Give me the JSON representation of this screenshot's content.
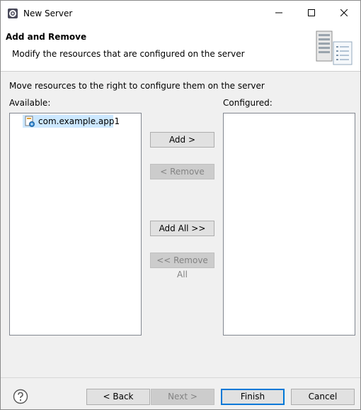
{
  "window": {
    "title": "New Server",
    "icons": {
      "app": "server-gear-icon",
      "minimize": "minimize-icon",
      "maximize": "maximize-icon",
      "close": "close-icon"
    }
  },
  "banner": {
    "title": "Add and Remove",
    "message": "Modify the resources that are configured on the server",
    "image": "server-document-icon"
  },
  "instruction": "Move resources to the right to configure them on the server",
  "available": {
    "label": "Available:",
    "items": [
      {
        "label": "com.example.app1",
        "icon": "web-module-icon",
        "selected": true
      }
    ]
  },
  "configured": {
    "label": "Configured:",
    "items": []
  },
  "actions": {
    "add": "Add >",
    "remove": "< Remove",
    "add_all": "Add All >>",
    "remove_all": "<< Remove All"
  },
  "footer": {
    "help_icon": "help-icon",
    "back": "< Back",
    "next": "Next >",
    "finish": "Finish",
    "cancel": "Cancel"
  },
  "colors": {
    "selection": "#cce8ff",
    "default_button_border": "#0078d7"
  }
}
